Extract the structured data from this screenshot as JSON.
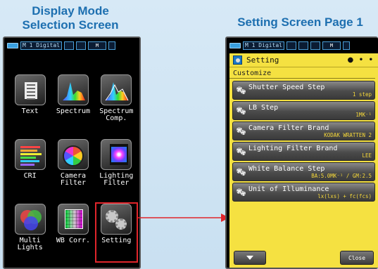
{
  "captions": {
    "left": "Display Mode\nSelection Screen",
    "right": "Setting Screen  Page 1"
  },
  "statusbar": {
    "mode": "M 1",
    "label": "Digital",
    "m_marker": "M"
  },
  "menu": {
    "tiles": [
      {
        "label": "Text",
        "icon": "text-icon"
      },
      {
        "label": "Spectrum",
        "icon": "spectrum-icon"
      },
      {
        "label": "Spectrum\nComp.",
        "icon": "spectrum-comp-icon"
      },
      {
        "label": "CRI",
        "icon": "cri-icon"
      },
      {
        "label": "Camera\nFilter",
        "icon": "camera-filter-icon"
      },
      {
        "label": "Lighting\nFilter",
        "icon": "lighting-filter-icon"
      },
      {
        "label": "Multi\nLights",
        "icon": "multi-lights-icon"
      },
      {
        "label": "WB Corr.",
        "icon": "wb-corr-icon"
      },
      {
        "label": "Setting",
        "icon": "setting-icon",
        "selected": true
      }
    ]
  },
  "setting": {
    "title": "Setting",
    "page_indicator": "● • •",
    "section": "Customize",
    "items": [
      {
        "name": "Shutter Speed Step",
        "value": "1 step"
      },
      {
        "name": "LB Step",
        "value": "1MK⁻¹"
      },
      {
        "name": "Camera Filter Brand",
        "value": "KODAK WRATTEN 2"
      },
      {
        "name": "Lighting Filter Brand",
        "value": "LEE"
      },
      {
        "name": "White Balance Step",
        "value": "BA:5.0MK⁻¹ / GM:2.5"
      },
      {
        "name": "Unit of Illuminance",
        "value": "lx(lxs) + fc(fcs)"
      }
    ],
    "close_label": "Close",
    "down_icon": "triangle-down-icon"
  },
  "colors": {
    "caption": "#1d6fb0",
    "panel": "#f5e141",
    "selection": "#e0252b",
    "value": "#f6d83a"
  }
}
